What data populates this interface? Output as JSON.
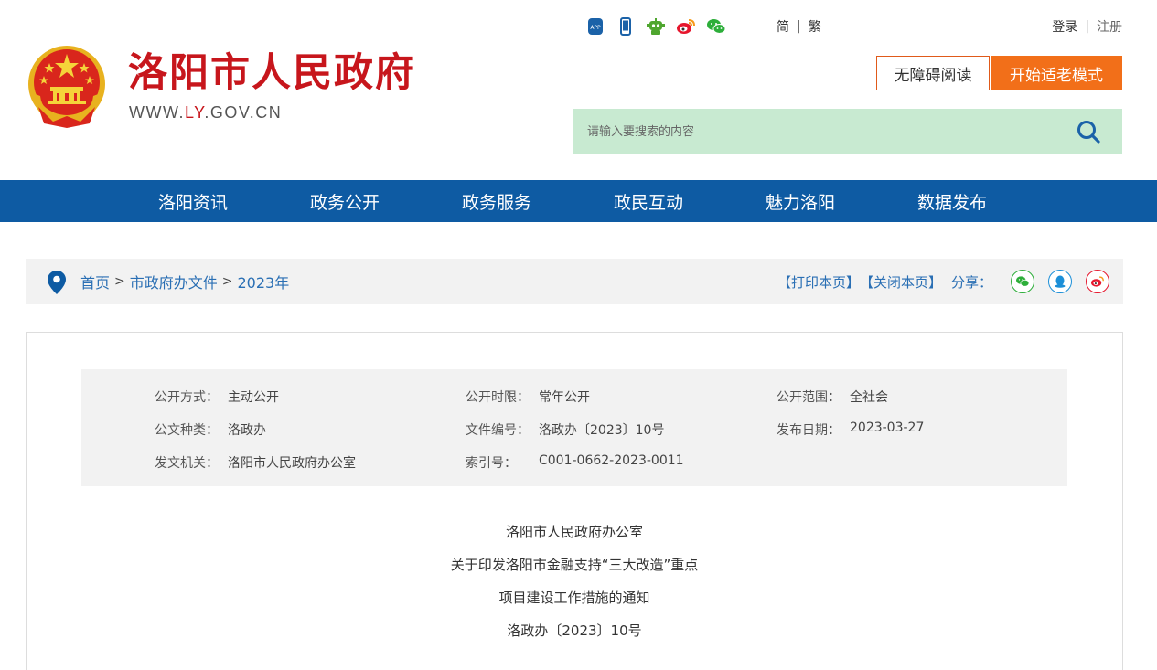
{
  "header": {
    "site_name": "洛阳市人民政府",
    "url_prefix": "WWW.",
    "url_ly": "LY",
    "url_suffix": ".GOV.CN",
    "top_icons": [
      "app-icon",
      "mobile-icon",
      "robot-icon",
      "weibo-icon",
      "wechat-icon"
    ],
    "lang_simplified": "简",
    "lang_traditional": "繁",
    "lang_sep": "|",
    "login": "登录",
    "register": "注册",
    "auth_sep": "|",
    "accessible_button": "无障碍阅读",
    "elder_button": "开始适老模式",
    "search_placeholder": "请输入要搜索的内容"
  },
  "nav": {
    "items": [
      "洛阳资讯",
      "政务公开",
      "政务服务",
      "政民互动",
      "魅力洛阳",
      "数据发布"
    ]
  },
  "breadcrumb": {
    "items": [
      "首页",
      "市政府办文件",
      "2023年"
    ],
    "separator": ">"
  },
  "tools": {
    "print": "【打印本页】",
    "close": "【关闭本页】",
    "share_label": "分享："
  },
  "meta": {
    "disclosure_method_label": "公开方式：",
    "disclosure_method": "主动公开",
    "disclosure_period_label": "公开时限：",
    "disclosure_period": "常年公开",
    "disclosure_scope_label": "公开范围：",
    "disclosure_scope": "全社会",
    "doc_type_label": "公文种类：",
    "doc_type": "洛政办",
    "doc_number_label": "文件编号：",
    "doc_number": "洛政办〔2023〕10号",
    "publish_date_label": "发布日期：",
    "publish_date": "2023-03-27",
    "issuer_label": "发文机关：",
    "issuer": "洛阳市人民政府办公室",
    "index_label": "索引号：",
    "index_no": "C001-0662-2023-0011"
  },
  "document": {
    "line1": "洛阳市人民政府办公室",
    "line2": "关于印发洛阳市金融支持“三大改造”重点",
    "line3": "项目建设工作措施的通知",
    "line4": "洛政办〔2023〕10号"
  },
  "colors": {
    "brand_red": "#c7161c",
    "nav_blue": "#0e5ba3",
    "link_blue": "#2a6fb4",
    "elder_orange": "#f26f19",
    "search_green": "#c8ead1"
  }
}
